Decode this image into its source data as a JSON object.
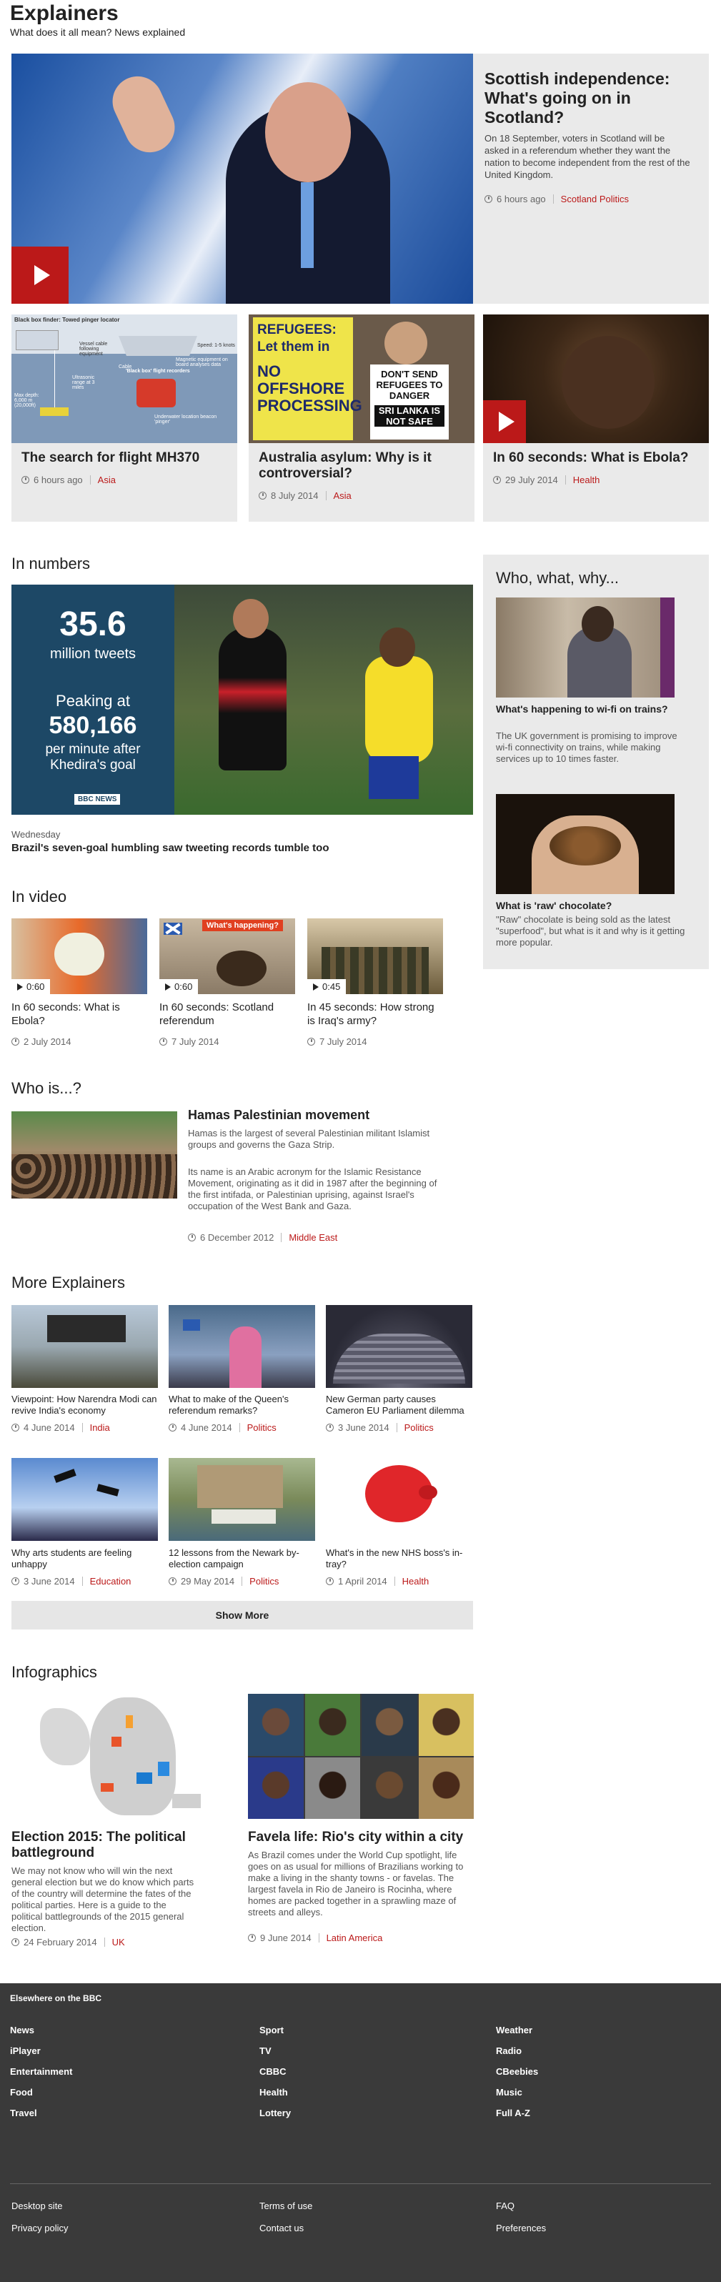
{
  "page": {
    "title": "Explainers",
    "subtitle": "What does it all mean? News explained"
  },
  "hero": {
    "title": "Scottish independence: What's going on in Scotland?",
    "summary": "On 18 September, voters in Scotland will be asked in a referendum whether they want the nation to become independent from the rest of the United Kingdom.",
    "time": "6 hours ago",
    "tag": "Scotland Politics"
  },
  "row2": [
    {
      "title": "The search for flight MH370",
      "time": "6 hours ago",
      "tag": "Asia",
      "graphic_title": "Black box finder: Towed pinger locator",
      "graphic_labels": [
        "Magnetic equipment on board analyses data",
        "Vessel cable following equipment",
        "Speed: 1-5 knots",
        "Cable",
        "Ultrasonic range at 3 miles",
        "Max depth: 6,000 m (20,000ft)",
        "'Black box' flight recorders",
        "Underwater location beacon 'pinger'"
      ]
    },
    {
      "title": "Australia asylum: Why is it controversial?",
      "time": "8 July 2014",
      "tag": "Asia",
      "signs": [
        "REFUGEES: Let them in",
        "NO OFFSHORE PROCESSING",
        "DON'T SEND REFUGEES TO DANGER",
        "SRI LANKA IS NOT SAFE"
      ]
    },
    {
      "title": "In 60 seconds: What is Ebola?",
      "time": "29 July 2014",
      "tag": "Health"
    }
  ],
  "numbers": {
    "heading": "In numbers",
    "big": "35.6",
    "big_sub": "million tweets",
    "peak_label": "Peaking at",
    "peak_value": "580,166",
    "peak_sub": "per minute after Khedira's goal",
    "brand": "BBC NEWS",
    "date": "Wednesday",
    "caption": "Brazil's seven-goal humbling saw tweeting records tumble too"
  },
  "www": {
    "heading": "Who, what, why...",
    "items": [
      {
        "title": "What's happening to wi-fi on trains?",
        "summary": "The UK government is promising to improve wi-fi connectivity on trains, while making services up to 10 times faster."
      },
      {
        "title": "What is 'raw' chocolate?",
        "summary": "\"Raw\" chocolate is being sold as the latest \"superfood\", but what is it and why is it getting more popular."
      }
    ]
  },
  "video": {
    "heading": "In video",
    "items": [
      {
        "duration": "0:60",
        "title": "In 60 seconds: What is Ebola?",
        "date": "2 July 2014"
      },
      {
        "duration": "0:60",
        "title": "In 60 seconds: Scotland referendum",
        "date": "7 July 2014",
        "overlay": "What's happening?"
      },
      {
        "duration": "0:45",
        "title": "In 45 seconds: How strong is Iraq's army?",
        "date": "7 July 2014"
      }
    ]
  },
  "whois": {
    "heading": "Who is...?",
    "title": "Hamas Palestinian movement",
    "p1": "Hamas is the largest of several Palestinian militant Islamist groups and governs the Gaza Strip.",
    "p2": "Its name is an Arabic acronym for the Islamic Resistance Movement, originating as it did in 1987 after the beginning of the first intifada, or Palestinian uprising, against Israel's occupation of the West Bank and Gaza.",
    "time": "6 December 2012",
    "tag": "Middle East"
  },
  "more": {
    "heading": "More Explainers",
    "items": [
      {
        "title": "Viewpoint: How Narendra Modi can revive India's economy",
        "time": "4 June 2014",
        "tag": "India"
      },
      {
        "title": "What to make of the Queen's referendum remarks?",
        "time": "4 June 2014",
        "tag": "Politics"
      },
      {
        "title": "New German party causes Cameron EU Parliament dilemma",
        "time": "3 June 2014",
        "tag": "Politics"
      },
      {
        "title": "Why arts students are feeling unhappy",
        "time": "3 June 2014",
        "tag": "Education"
      },
      {
        "title": "12 lessons from the Newark by-election campaign",
        "time": "29 May 2014",
        "tag": "Politics"
      },
      {
        "title": "What's in the new NHS boss's in-tray?",
        "time": "1 April 2014",
        "tag": "Health"
      }
    ],
    "show_more": "Show More"
  },
  "info": {
    "heading": "Infographics",
    "items": [
      {
        "title": "Election 2015: The political battleground",
        "summary": "We may not know who will win the next general election but we do know which parts of the country will determine the fates of the political parties. Here is a guide to the political battlegrounds of the 2015 general election.",
        "time": "24 February 2014",
        "tag": "UK"
      },
      {
        "title": "Favela life: Rio's city within a city",
        "summary": "As Brazil comes under the World Cup spotlight, life goes on as usual for millions of Brazilians working to make a living in the shanty towns - or favelas. The largest favela in Rio de Janeiro is Rocinha, where homes are packed together in a sprawling maze of streets and alleys.",
        "time": "9 June 2014",
        "tag": "Latin America"
      }
    ]
  },
  "footer": {
    "heading": "Elsewhere on the BBC",
    "cols": [
      [
        "News",
        "iPlayer",
        "Entertainment",
        "Food",
        "Travel"
      ],
      [
        "Sport",
        "TV",
        "CBBC",
        "Health",
        "Lottery"
      ],
      [
        "Weather",
        "Radio",
        "CBeebies",
        "Music",
        "Full A-Z"
      ]
    ],
    "bottom": [
      [
        "Desktop site",
        "Privacy policy"
      ],
      [
        "Terms of use",
        "Contact us"
      ],
      [
        "FAQ",
        "Preferences"
      ]
    ]
  },
  "colors": {
    "accent": "#bb1919",
    "card": "#eaeaea",
    "footer": "#3a3a3a"
  }
}
